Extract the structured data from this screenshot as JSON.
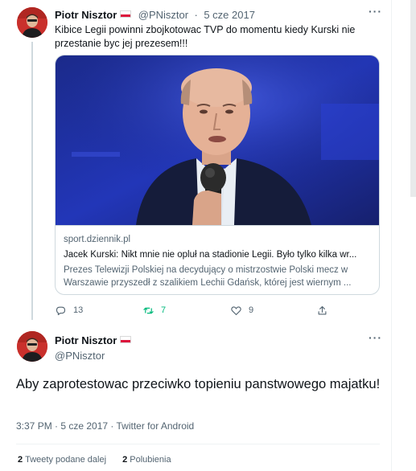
{
  "tweet1": {
    "author_name": "Piotr Nisztor",
    "handle": "@PNisztor",
    "separator": "·",
    "date": "5 cze 2017",
    "text": "Kibice Legii powinni zbojkotowac TVP do momentu kiedy Kurski nie przestanie byc jej prezesem!!!",
    "card": {
      "domain": "sport.dziennik.pl",
      "title": "Jacek Kurski: Nikt mnie nie opluł na stadionie Legii. Było tylko kilka wr...",
      "description": "Prezes Telewizji Polskiej na decydujący o mistrzostwie Polski mecz w Warszawie przyszedł z szalikiem Lechii Gdańsk, której jest wiernym ..."
    },
    "replies": "13",
    "retweets": "7",
    "likes": "9"
  },
  "tweet2": {
    "author_name": "Piotr Nisztor",
    "handle": "@PNisztor",
    "text": "Aby zaprotestowac przeciwko topieniu panstwowego majatku!",
    "meta": "3:37 PM · 5 cze 2017 · Twitter for Android",
    "retweets_count": "2",
    "retweets_label": "Tweety podane dalej",
    "likes_count": "2",
    "likes_label": "Polubienia"
  },
  "icons": {
    "more": "more-icon",
    "reply": "reply-icon",
    "retweet": "retweet-icon",
    "like": "heart-icon",
    "share": "share-icon",
    "flag": "poland-flag-icon"
  },
  "colors": {
    "text": "#0f1419",
    "secondary": "#536471",
    "retweet_active": "#00ba7c",
    "border": "#cfd9de"
  }
}
